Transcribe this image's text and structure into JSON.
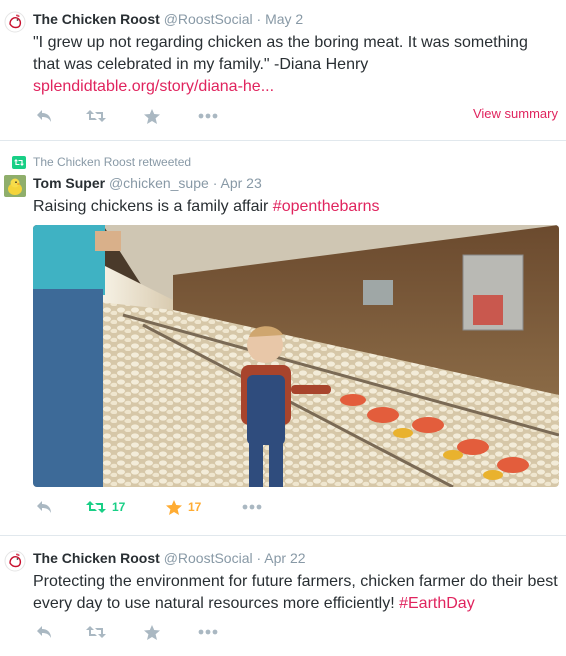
{
  "tweets": [
    {
      "name": "The Chicken Roost",
      "handle": "@RoostSocial",
      "separator": "·",
      "date": "May 2",
      "text": "\"I grew up not regarding chicken as the boring meat. It was something that was celebrated in my family.\" -Diana Henry ",
      "link": "splendidtable.org/story/diana-he...",
      "view_summary": "View summary"
    },
    {
      "retweeted_by": "The Chicken Roost retweeted",
      "name": "Tom Super",
      "handle": "@chicken_supe",
      "separator": "·",
      "date": "Apr 23",
      "text": "Raising chickens is a family affair ",
      "hashtag": "#openthebarns",
      "retweet_count": "17",
      "favorite_count": "17"
    },
    {
      "name": "The Chicken Roost",
      "handle": "@RoostSocial",
      "separator": "·",
      "date": "Apr 22",
      "text": "Protecting the environment for future farmers, chicken farmer do their best every day to use natural resources more efficiently! ",
      "hashtag": "#EarthDay"
    }
  ],
  "icons": {
    "reply": "reply-icon",
    "retweet": "retweet-icon",
    "favorite": "star-icon",
    "more": "more-icon",
    "avatar_roost": "chicken-logo-icon",
    "avatar_tom": "chick-avatar-icon"
  },
  "colors": {
    "link": "#e0245e",
    "muted": "#8899a6",
    "action": "#aab8c2",
    "retweet_active": "#19cf86",
    "favorite_active": "#ffac33"
  }
}
